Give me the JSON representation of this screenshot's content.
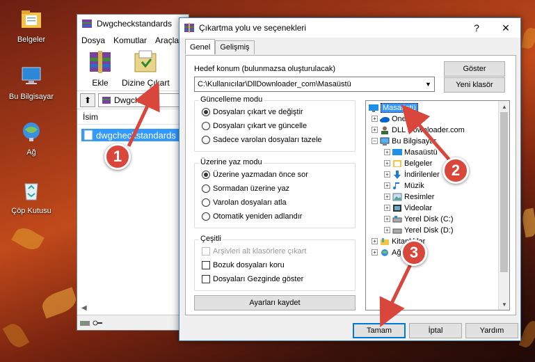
{
  "desktop": {
    "icons": [
      {
        "label": "Belgeler",
        "icon": "folder-documents-icon"
      },
      {
        "label": "Bu Bilgisayar",
        "icon": "computer-icon"
      },
      {
        "label": "Ağ",
        "icon": "network-icon"
      },
      {
        "label": "Çöp Kutusu",
        "icon": "recycle-bin-icon"
      }
    ]
  },
  "winrar": {
    "title": "Dwgcheckstandards",
    "menu": [
      "Dosya",
      "Komutlar",
      "Araçla"
    ],
    "toolbar": {
      "extract": "Ekle",
      "extract_to": "Dizine Çıkart"
    },
    "path": "Dwgchecks",
    "column": "İsim",
    "file": "dwgcheckstandards"
  },
  "dialog": {
    "title": "Çıkartma yolu ve seçenekleri",
    "help": "?",
    "close": "✕",
    "tabs": [
      "Genel",
      "Gelişmiş"
    ],
    "dest_label": "Hedef konum (bulunmazsa oluşturulacak)",
    "dest_value": "C:\\Kullanıcılar\\DllDownloader_com\\Masaüstü",
    "show_button": "Göster",
    "new_folder_button": "Yeni klasör",
    "update_mode": {
      "title": "Güncelleme modu",
      "options": [
        "Dosyaları çıkart ve değiştir",
        "Dosyaları çıkart ve güncelle",
        "Sadece varolan dosyaları tazele"
      ],
      "selected": 0
    },
    "overwrite_mode": {
      "title": "Üzerine yaz modu",
      "options": [
        "Üzerine yazmadan önce sor",
        "Sormadan üzerine yaz",
        "Varolan dosyaları atla",
        "Otomatik yeniden adlandır"
      ],
      "selected": 0
    },
    "misc": {
      "title": "Çeşitli",
      "options": [
        "Arşivleri alt klasörlere çıkart",
        "Bozuk dosyaları koru",
        "Dosyaları Gezginde göster"
      ],
      "disabled": [
        true,
        false,
        false
      ]
    },
    "save_settings": "Ayarları kaydet",
    "tree": [
      {
        "label": "Masaüstü",
        "icon": "desktop-icon",
        "level": 0,
        "selected": true
      },
      {
        "label": "OneDrive",
        "icon": "onedrive-icon",
        "level": 1
      },
      {
        "label": "DLL Downloader.com",
        "icon": "user-icon",
        "level": 1
      },
      {
        "label": "Bu Bilgisayar",
        "icon": "computer-icon",
        "level": 1,
        "expanded": true
      },
      {
        "label": "Masaüstü",
        "icon": "desktop-icon",
        "level": 2
      },
      {
        "label": "Belgeler",
        "icon": "documents-icon",
        "level": 2
      },
      {
        "label": "İndirilenler",
        "icon": "downloads-icon",
        "level": 2
      },
      {
        "label": "Müzik",
        "icon": "music-icon",
        "level": 2
      },
      {
        "label": "Resimler",
        "icon": "pictures-icon",
        "level": 2
      },
      {
        "label": "Videolar",
        "icon": "videos-icon",
        "level": 2
      },
      {
        "label": "Yerel Disk (C:)",
        "icon": "drive-icon",
        "level": 2
      },
      {
        "label": "Yerel Disk (D:)",
        "icon": "drive-icon",
        "level": 2
      },
      {
        "label": "Kitaplıklar",
        "icon": "libraries-icon",
        "level": 1
      },
      {
        "label": "Ağ",
        "icon": "network-icon",
        "level": 1
      }
    ],
    "ok": "Tamam",
    "cancel": "İptal",
    "help_button": "Yardım"
  },
  "annotations": [
    "1",
    "2",
    "3"
  ],
  "colors": {
    "selection": "#3399ff",
    "marker": "#d9463b",
    "focus": "#0078d7"
  }
}
